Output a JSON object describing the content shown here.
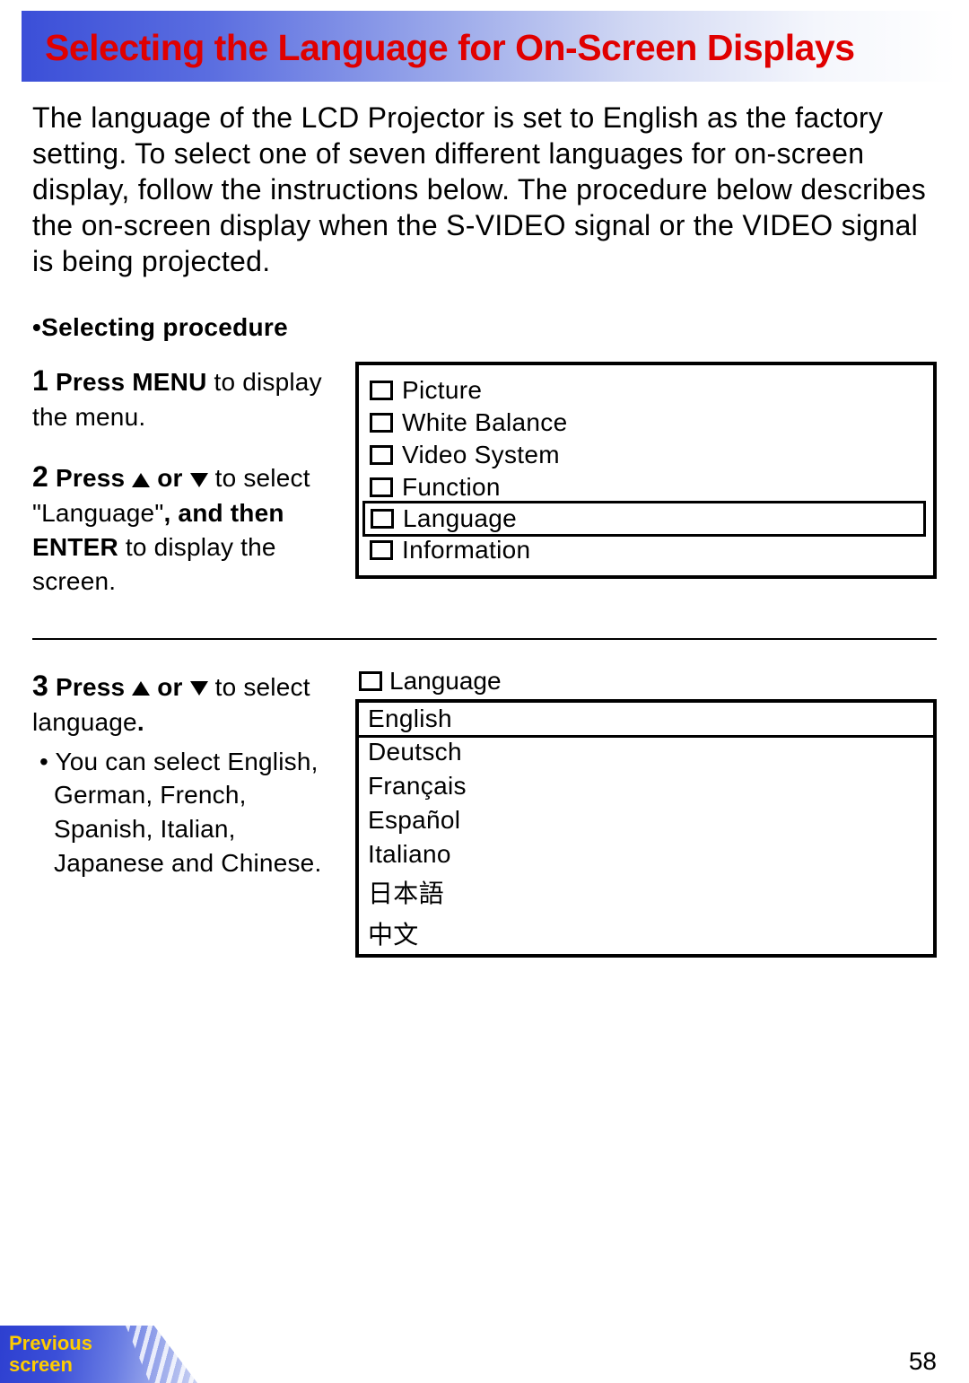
{
  "header": {
    "title": "Selecting the Language for On-Screen Displays"
  },
  "intro": "The language of the LCD Projector is set to English as the factory setting. To select one of seven different languages for on-screen display, follow the instructions below. The procedure below describes the on-screen display when the S-VIDEO signal or the VIDEO signal is being projected.",
  "section_label": "•Selecting procedure",
  "steps": {
    "s1": {
      "num": "1",
      "b1": "Press MENU",
      "t1": " to display the menu."
    },
    "s2": {
      "num": "2",
      "b1": "Press ",
      "t1": " or ",
      "t2": " to select \"Language\"",
      "b2": ", and then ENTER",
      "t3": " to display the screen."
    },
    "s3": {
      "num": "3",
      "b1": "Press ",
      "t1": " or ",
      "t2": " to select language",
      "b2": ".",
      "note": "• You can select English, German, French, Spanish, Italian, Japanese and Chinese."
    }
  },
  "menu1": {
    "items": [
      "Picture",
      "White Balance",
      "Video System",
      "Function",
      "Language",
      "Information"
    ],
    "selected_index": 4
  },
  "menu2": {
    "header": "Language",
    "items": [
      "English",
      "Deutsch",
      "Français",
      "Español",
      "Italiano",
      "日本語",
      "中文"
    ],
    "selected_index": 0
  },
  "footer": {
    "prev": "Previous\nscreen",
    "page": "58"
  }
}
